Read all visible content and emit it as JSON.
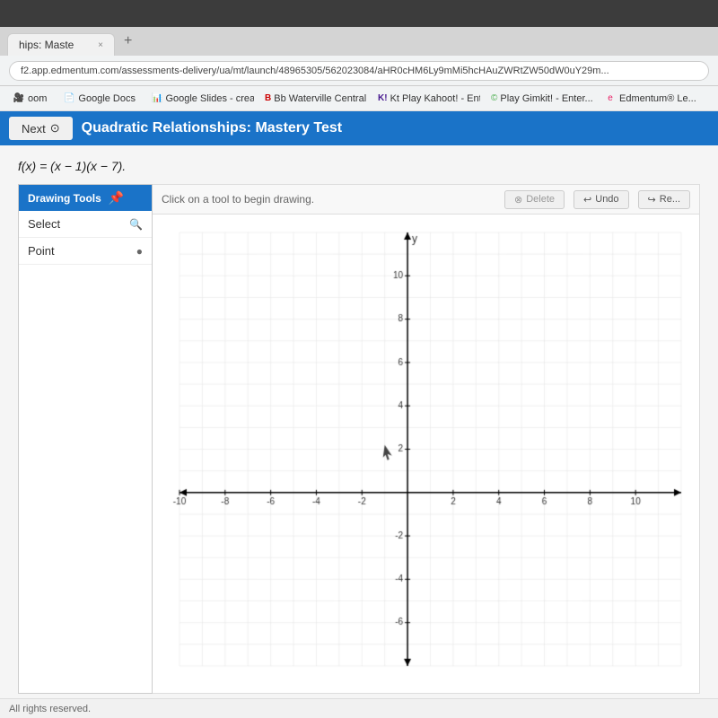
{
  "browser": {
    "tab_title": "hips: Maste",
    "tab_close": "×",
    "tab_plus": "+",
    "address_url": "f2.app.edmentum.com/assessments-delivery/ua/mt/launch/48965305/562023084/aHR0cHM6Ly9mMi5hcHAuZWRtZW50dW0uY29m...",
    "bookmarks": [
      {
        "label": "oom",
        "icon": "🎥"
      },
      {
        "label": "Google Docs",
        "icon": "📄"
      },
      {
        "label": "Google Slides - crea...",
        "icon": "📊"
      },
      {
        "label": "Bb  Waterville Central S...",
        "icon": "B"
      },
      {
        "label": "Kt  Play Kahoot! - Ente...",
        "icon": "K"
      },
      {
        "label": "Play Gimkit! - Enter...",
        "icon": "©"
      },
      {
        "label": "Edmentum® Le...",
        "icon": "e"
      }
    ]
  },
  "nav": {
    "next_label": "Next",
    "next_icon": "⊙",
    "title": "Quadratic Relationships: Mastery Test"
  },
  "question": {
    "text": "f(x) = (x − 1)(x − 7)."
  },
  "drawing_tools": {
    "header": "Drawing Tools",
    "pin_icon": "📌",
    "tools": [
      {
        "label": "Select",
        "icon": "🔍"
      },
      {
        "label": "Point",
        "icon": "•"
      }
    ]
  },
  "graph_toolbar": {
    "hint": "Click on a tool to begin drawing.",
    "delete_label": "Delete",
    "undo_label": "Undo",
    "redo_label": "Re..."
  },
  "graph": {
    "x_min": -10,
    "x_max": 10,
    "y_min": -8,
    "y_max": 10,
    "x_labels": [
      "-10",
      "-8",
      "-6",
      "-4",
      "-2",
      "2",
      "4",
      "6",
      "8",
      "10"
    ],
    "y_labels": [
      "-6",
      "-4",
      "-2",
      "2",
      "4",
      "6",
      "8",
      "10"
    ],
    "axis_color": "#000",
    "grid_color": "#e0e0e0"
  },
  "footer": {
    "text": "All rights reserved."
  }
}
